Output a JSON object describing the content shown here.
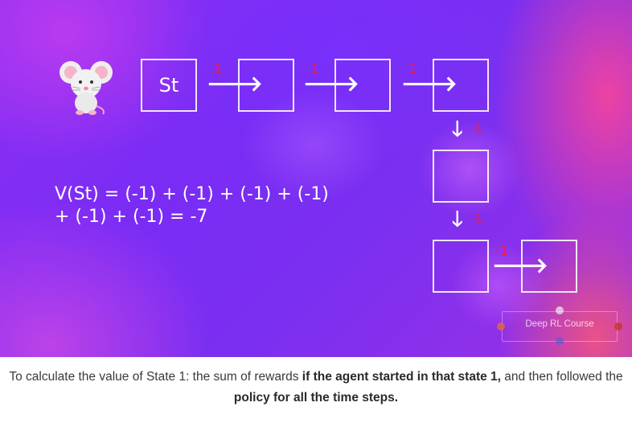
{
  "diagram": {
    "states": [
      {
        "id": "s1",
        "label": "St"
      },
      {
        "id": "s2",
        "label": ""
      },
      {
        "id": "s3",
        "label": ""
      },
      {
        "id": "s4",
        "label": ""
      },
      {
        "id": "s5",
        "label": ""
      },
      {
        "id": "s6",
        "label": ""
      },
      {
        "id": "s7",
        "label": ""
      }
    ],
    "transitions": [
      {
        "from": "s1",
        "to": "s2",
        "reward": "-1"
      },
      {
        "from": "s2",
        "to": "s3",
        "reward": "-1"
      },
      {
        "from": "s3",
        "to": "s4",
        "reward": "-1"
      },
      {
        "from": "s4",
        "to": "s5",
        "reward": "-1"
      },
      {
        "from": "s5",
        "to": "s6",
        "reward": "-1"
      },
      {
        "from": "s6",
        "to": "s7",
        "reward": "-1"
      }
    ],
    "equation": {
      "line1": "V(St) = (-1) + (-1) + (-1) + (-1)",
      "line2": "+ (-1) + (-1) = -7"
    },
    "agent_icon": "mouse-icon",
    "watermark": "Deep RL Course",
    "colors": {
      "box_border": "#ffffff",
      "reward": "#ee1b4a",
      "arrow": "#ffffff"
    }
  },
  "caption": {
    "part1": "To calculate the value of State 1: the sum of rewards ",
    "bold1": "if the agent started in that state 1,",
    "part2": " and then followed the ",
    "bold2": "policy for all the time steps."
  }
}
